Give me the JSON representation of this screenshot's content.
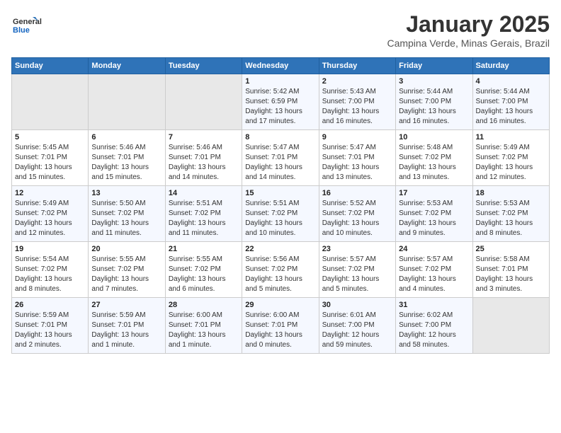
{
  "header": {
    "logo_line1": "General",
    "logo_line2": "Blue",
    "title": "January 2025",
    "subtitle": "Campina Verde, Minas Gerais, Brazil"
  },
  "weekdays": [
    "Sunday",
    "Monday",
    "Tuesday",
    "Wednesday",
    "Thursday",
    "Friday",
    "Saturday"
  ],
  "weeks": [
    [
      {
        "day": "",
        "info": ""
      },
      {
        "day": "",
        "info": ""
      },
      {
        "day": "",
        "info": ""
      },
      {
        "day": "1",
        "info": "Sunrise: 5:42 AM\nSunset: 6:59 PM\nDaylight: 13 hours and 17 minutes."
      },
      {
        "day": "2",
        "info": "Sunrise: 5:43 AM\nSunset: 7:00 PM\nDaylight: 13 hours and 16 minutes."
      },
      {
        "day": "3",
        "info": "Sunrise: 5:44 AM\nSunset: 7:00 PM\nDaylight: 13 hours and 16 minutes."
      },
      {
        "day": "4",
        "info": "Sunrise: 5:44 AM\nSunset: 7:00 PM\nDaylight: 13 hours and 16 minutes."
      }
    ],
    [
      {
        "day": "5",
        "info": "Sunrise: 5:45 AM\nSunset: 7:01 PM\nDaylight: 13 hours and 15 minutes."
      },
      {
        "day": "6",
        "info": "Sunrise: 5:46 AM\nSunset: 7:01 PM\nDaylight: 13 hours and 15 minutes."
      },
      {
        "day": "7",
        "info": "Sunrise: 5:46 AM\nSunset: 7:01 PM\nDaylight: 13 hours and 14 minutes."
      },
      {
        "day": "8",
        "info": "Sunrise: 5:47 AM\nSunset: 7:01 PM\nDaylight: 13 hours and 14 minutes."
      },
      {
        "day": "9",
        "info": "Sunrise: 5:47 AM\nSunset: 7:01 PM\nDaylight: 13 hours and 13 minutes."
      },
      {
        "day": "10",
        "info": "Sunrise: 5:48 AM\nSunset: 7:02 PM\nDaylight: 13 hours and 13 minutes."
      },
      {
        "day": "11",
        "info": "Sunrise: 5:49 AM\nSunset: 7:02 PM\nDaylight: 13 hours and 12 minutes."
      }
    ],
    [
      {
        "day": "12",
        "info": "Sunrise: 5:49 AM\nSunset: 7:02 PM\nDaylight: 13 hours and 12 minutes."
      },
      {
        "day": "13",
        "info": "Sunrise: 5:50 AM\nSunset: 7:02 PM\nDaylight: 13 hours and 11 minutes."
      },
      {
        "day": "14",
        "info": "Sunrise: 5:51 AM\nSunset: 7:02 PM\nDaylight: 13 hours and 11 minutes."
      },
      {
        "day": "15",
        "info": "Sunrise: 5:51 AM\nSunset: 7:02 PM\nDaylight: 13 hours and 10 minutes."
      },
      {
        "day": "16",
        "info": "Sunrise: 5:52 AM\nSunset: 7:02 PM\nDaylight: 13 hours and 10 minutes."
      },
      {
        "day": "17",
        "info": "Sunrise: 5:53 AM\nSunset: 7:02 PM\nDaylight: 13 hours and 9 minutes."
      },
      {
        "day": "18",
        "info": "Sunrise: 5:53 AM\nSunset: 7:02 PM\nDaylight: 13 hours and 8 minutes."
      }
    ],
    [
      {
        "day": "19",
        "info": "Sunrise: 5:54 AM\nSunset: 7:02 PM\nDaylight: 13 hours and 8 minutes."
      },
      {
        "day": "20",
        "info": "Sunrise: 5:55 AM\nSunset: 7:02 PM\nDaylight: 13 hours and 7 minutes."
      },
      {
        "day": "21",
        "info": "Sunrise: 5:55 AM\nSunset: 7:02 PM\nDaylight: 13 hours and 6 minutes."
      },
      {
        "day": "22",
        "info": "Sunrise: 5:56 AM\nSunset: 7:02 PM\nDaylight: 13 hours and 5 minutes."
      },
      {
        "day": "23",
        "info": "Sunrise: 5:57 AM\nSunset: 7:02 PM\nDaylight: 13 hours and 5 minutes."
      },
      {
        "day": "24",
        "info": "Sunrise: 5:57 AM\nSunset: 7:02 PM\nDaylight: 13 hours and 4 minutes."
      },
      {
        "day": "25",
        "info": "Sunrise: 5:58 AM\nSunset: 7:01 PM\nDaylight: 13 hours and 3 minutes."
      }
    ],
    [
      {
        "day": "26",
        "info": "Sunrise: 5:59 AM\nSunset: 7:01 PM\nDaylight: 13 hours and 2 minutes."
      },
      {
        "day": "27",
        "info": "Sunrise: 5:59 AM\nSunset: 7:01 PM\nDaylight: 13 hours and 1 minute."
      },
      {
        "day": "28",
        "info": "Sunrise: 6:00 AM\nSunset: 7:01 PM\nDaylight: 13 hours and 1 minute."
      },
      {
        "day": "29",
        "info": "Sunrise: 6:00 AM\nSunset: 7:01 PM\nDaylight: 13 hours and 0 minutes."
      },
      {
        "day": "30",
        "info": "Sunrise: 6:01 AM\nSunset: 7:00 PM\nDaylight: 12 hours and 59 minutes."
      },
      {
        "day": "31",
        "info": "Sunrise: 6:02 AM\nSunset: 7:00 PM\nDaylight: 12 hours and 58 minutes."
      },
      {
        "day": "",
        "info": ""
      }
    ]
  ]
}
